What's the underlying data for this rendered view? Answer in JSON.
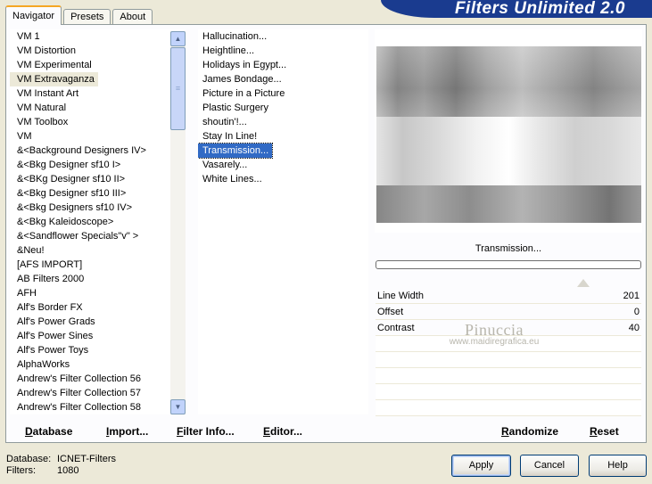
{
  "tabs": [
    {
      "label": "Navigator",
      "active": true
    },
    {
      "label": "Presets",
      "active": false
    },
    {
      "label": "About",
      "active": false
    }
  ],
  "banner": "Filters Unlimited 2.0",
  "categories": [
    "VM 1",
    "VM Distortion",
    "VM Experimental",
    "VM Extravaganza",
    "VM Instant Art",
    "VM Natural",
    "VM Toolbox",
    "VM",
    "&<Background Designers IV>",
    "&<Bkg Designer sf10 I>",
    "&<BKg Designer sf10 II>",
    "&<Bkg Designer sf10 III>",
    "&<Bkg Designers sf10 IV>",
    "&<Bkg Kaleidoscope>",
    "&<Sandflower Specials\"v\" >",
    "&Neu!",
    "[AFS IMPORT]",
    "AB Filters 2000",
    "AFH",
    "Alf's Border FX",
    "Alf's Power Grads",
    "Alf's Power Sines",
    "Alf's Power Toys",
    "AlphaWorks",
    "Andrew's Filter Collection 56",
    "Andrew's Filter Collection 57",
    "Andrew's Filter Collection 58"
  ],
  "selected_category": "VM Extravaganza",
  "filters": [
    "Hallucination...",
    "Heightline...",
    "Holidays in Egypt...",
    "James Bondage...",
    "Picture in a Picture",
    "Plastic Surgery",
    "shoutin'!...",
    "Stay In Line!",
    "Transmission...",
    "Vasarely...",
    "White Lines..."
  ],
  "selected_filter": "Transmission...",
  "preview_filter_name": "Transmission...",
  "params": [
    {
      "label": "Line Width",
      "value": "201"
    },
    {
      "label": "Offset",
      "value": "0"
    },
    {
      "label": "Contrast",
      "value": "40"
    }
  ],
  "watermark": {
    "name": "Pinuccia",
    "url": "www.maidiregrafica.eu"
  },
  "bottom_buttons": {
    "database": "Database",
    "import": "Import...",
    "filter_info": "Filter Info...",
    "editor": "Editor...",
    "randomize": "Randomize",
    "reset": "Reset"
  },
  "status": {
    "database_label": "Database:",
    "database_value": "ICNET-Filters",
    "filters_label": "Filters:",
    "filters_value": "1080"
  },
  "dialog_buttons": {
    "apply": "Apply",
    "cancel": "Cancel",
    "help": "Help"
  },
  "colors": {
    "selection": "#316ac5",
    "banner": "#1a3b8f",
    "window": "#ece9d8"
  }
}
